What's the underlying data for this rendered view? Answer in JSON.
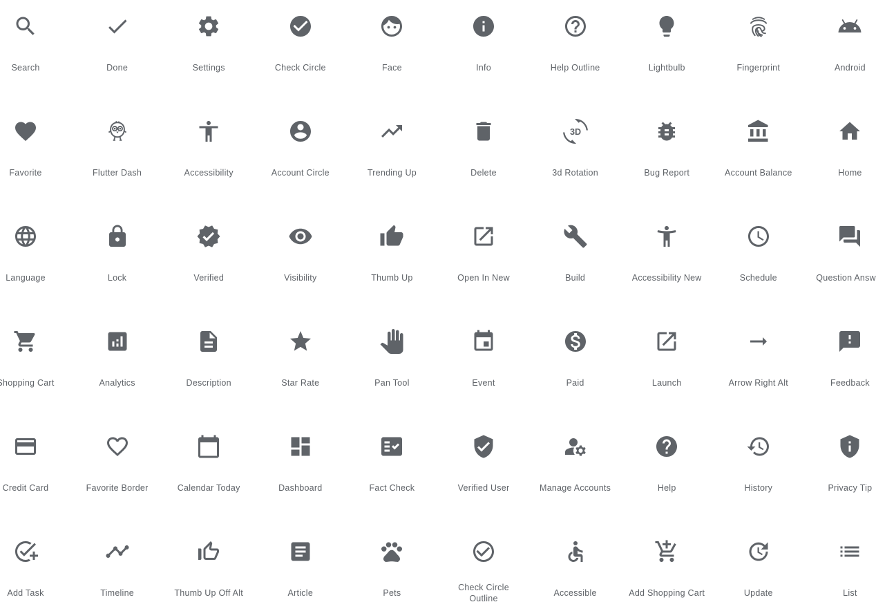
{
  "icon_color": "#5f6368",
  "tiles": [
    {
      "label": "Search",
      "icon": "search-icon"
    },
    {
      "label": "Done",
      "icon": "done-icon"
    },
    {
      "label": "Settings",
      "icon": "settings-icon"
    },
    {
      "label": "Check Circle",
      "icon": "check-circle-icon"
    },
    {
      "label": "Face",
      "icon": "face-icon"
    },
    {
      "label": "Info",
      "icon": "info-icon"
    },
    {
      "label": "Help Outline",
      "icon": "help-outline-icon"
    },
    {
      "label": "Lightbulb",
      "icon": "lightbulb-icon"
    },
    {
      "label": "Fingerprint",
      "icon": "fingerprint-icon"
    },
    {
      "label": "Android",
      "icon": "android-icon"
    },
    {
      "label": "Favorite",
      "icon": "favorite-icon"
    },
    {
      "label": "Flutter Dash",
      "icon": "flutter-dash-icon"
    },
    {
      "label": "Accessibility",
      "icon": "accessibility-icon"
    },
    {
      "label": "Account Circle",
      "icon": "account-circle-icon"
    },
    {
      "label": "Trending Up",
      "icon": "trending-up-icon"
    },
    {
      "label": "Delete",
      "icon": "delete-icon"
    },
    {
      "label": "3d Rotation",
      "icon": "3d-rotation-icon"
    },
    {
      "label": "Bug Report",
      "icon": "bug-report-icon"
    },
    {
      "label": "Account Balance",
      "icon": "account-balance-icon"
    },
    {
      "label": "Home",
      "icon": "home-icon"
    },
    {
      "label": "Language",
      "icon": "language-icon"
    },
    {
      "label": "Lock",
      "icon": "lock-icon"
    },
    {
      "label": "Verified",
      "icon": "verified-icon"
    },
    {
      "label": "Visibility",
      "icon": "visibility-icon"
    },
    {
      "label": "Thumb Up",
      "icon": "thumb-up-icon"
    },
    {
      "label": "Open In New",
      "icon": "open-in-new-icon"
    },
    {
      "label": "Build",
      "icon": "build-icon"
    },
    {
      "label": "Accessibility New",
      "icon": "accessibility-new-icon"
    },
    {
      "label": "Schedule",
      "icon": "schedule-icon"
    },
    {
      "label": "Question Answer",
      "icon": "question-answer-icon"
    },
    {
      "label": "Shopping Cart",
      "icon": "shopping-cart-icon"
    },
    {
      "label": "Analytics",
      "icon": "analytics-icon"
    },
    {
      "label": "Description",
      "icon": "description-icon"
    },
    {
      "label": "Star Rate",
      "icon": "star-rate-icon"
    },
    {
      "label": "Pan Tool",
      "icon": "pan-tool-icon"
    },
    {
      "label": "Event",
      "icon": "event-icon"
    },
    {
      "label": "Paid",
      "icon": "paid-icon"
    },
    {
      "label": "Launch",
      "icon": "launch-icon"
    },
    {
      "label": "Arrow Right Alt",
      "icon": "arrow-right-alt-icon"
    },
    {
      "label": "Feedback",
      "icon": "feedback-icon"
    },
    {
      "label": "Credit Card",
      "icon": "credit-card-icon"
    },
    {
      "label": "Favorite Border",
      "icon": "favorite-border-icon"
    },
    {
      "label": "Calendar Today",
      "icon": "calendar-today-icon"
    },
    {
      "label": "Dashboard",
      "icon": "dashboard-icon"
    },
    {
      "label": "Fact Check",
      "icon": "fact-check-icon"
    },
    {
      "label": "Verified User",
      "icon": "verified-user-icon"
    },
    {
      "label": "Manage Accounts",
      "icon": "manage-accounts-icon"
    },
    {
      "label": "Help",
      "icon": "help-icon"
    },
    {
      "label": "History",
      "icon": "history-icon"
    },
    {
      "label": "Privacy Tip",
      "icon": "privacy-tip-icon"
    },
    {
      "label": "Add Task",
      "icon": "add-task-icon"
    },
    {
      "label": "Timeline",
      "icon": "timeline-icon"
    },
    {
      "label": "Thumb Up Off Alt",
      "icon": "thumb-up-off-alt-icon"
    },
    {
      "label": "Article",
      "icon": "article-icon"
    },
    {
      "label": "Pets",
      "icon": "pets-icon"
    },
    {
      "label": "Check Circle Outline",
      "icon": "check-circle-outline-icon"
    },
    {
      "label": "Accessible",
      "icon": "accessible-icon"
    },
    {
      "label": "Add Shopping Cart",
      "icon": "add-shopping-cart-icon"
    },
    {
      "label": "Update",
      "icon": "update-icon"
    },
    {
      "label": "List",
      "icon": "list-icon"
    }
  ]
}
